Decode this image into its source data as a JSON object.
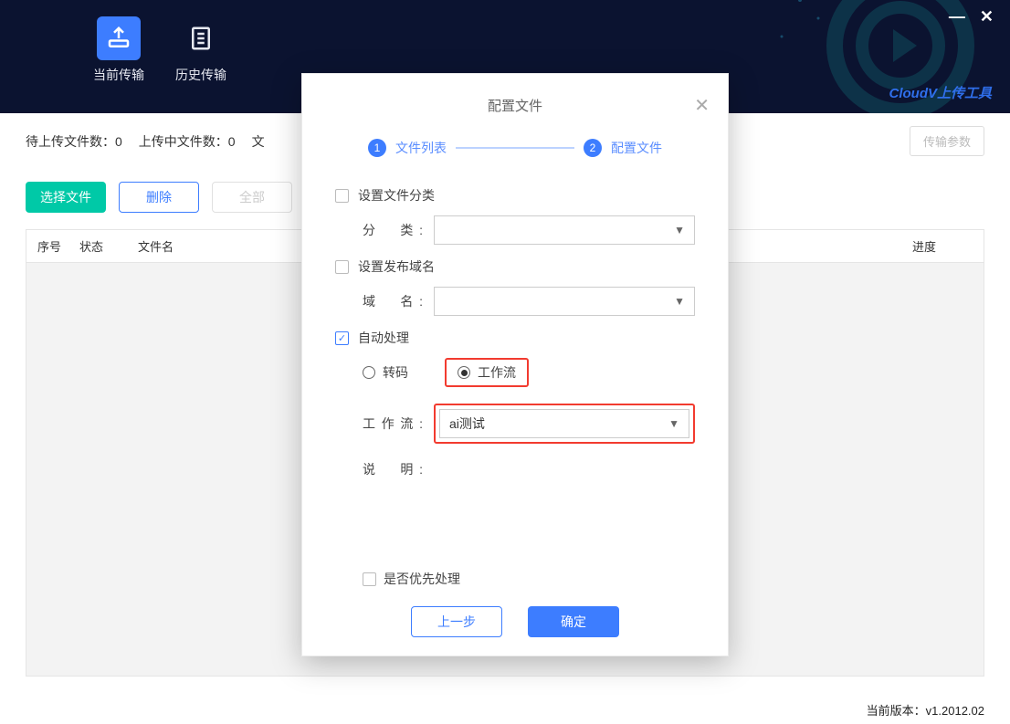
{
  "brand": "CloudV上传工具",
  "tabs": {
    "current": "当前传输",
    "history": "历史传输"
  },
  "status": {
    "pending_label": "待上传文件数：",
    "pending_count": "0",
    "uploading_label": "上传中文件数：",
    "uploading_count": "0",
    "more": "文",
    "params_btn": "传输参数"
  },
  "actions": {
    "select": "选择文件",
    "delete": "删除",
    "all": "全部"
  },
  "table": {
    "col_index": "序号",
    "col_status": "状态",
    "col_name": "文件名",
    "col_progress": "进度"
  },
  "modal": {
    "title": "配置文件",
    "step1": "文件列表",
    "step2": "配置文件",
    "set_category": "设置文件分类",
    "category_label": "分　类:",
    "set_domain": "设置发布域名",
    "domain_label": "域　名:",
    "auto_process": "自动处理",
    "radio_transcode": "转码",
    "radio_workflow": "工作流",
    "workflow_label": "工作流:",
    "workflow_value": "ai测试",
    "desc_label": "说　明:",
    "priority": "是否优先处理",
    "prev": "上一步",
    "confirm": "确定"
  },
  "footer": {
    "version_label": "当前版本：",
    "version": "v1.2012.02"
  }
}
